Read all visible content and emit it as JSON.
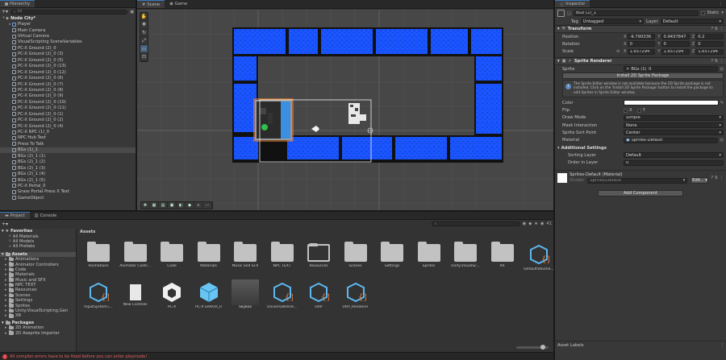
{
  "hierarchy": {
    "tab": "Hierarchy",
    "search_value": "All",
    "scene": "Node City*",
    "items": [
      {
        "label": "Player",
        "level": 1,
        "arrow": "▸"
      },
      {
        "label": "Main Camera",
        "level": 1,
        "arrow": ""
      },
      {
        "label": "Virtual Camera",
        "level": 1,
        "arrow": ""
      },
      {
        "label": "VisualScripting SceneVariables",
        "level": 1,
        "arrow": ""
      },
      {
        "label": "PC-X Ground (2)_0",
        "level": 1,
        "arrow": ""
      },
      {
        "label": "PC-X Ground (2)_0 (3)",
        "level": 1,
        "arrow": ""
      },
      {
        "label": "PC-X Ground (2)_0 (5)",
        "level": 1,
        "arrow": ""
      },
      {
        "label": "PC-X Ground (2)_0 (13)",
        "level": 1,
        "arrow": ""
      },
      {
        "label": "PC-X Ground (2)_0 (12)",
        "level": 1,
        "arrow": ""
      },
      {
        "label": "PC-X Ground (2)_0 (6)",
        "level": 1,
        "arrow": ""
      },
      {
        "label": "PC-X Ground (2)_0 (7)",
        "level": 1,
        "arrow": ""
      },
      {
        "label": "PC-X Ground (2)_0 (8)",
        "level": 1,
        "arrow": ""
      },
      {
        "label": "PC-X Ground (2)_0 (9)",
        "level": 1,
        "arrow": ""
      },
      {
        "label": "PC-X Ground (2)_0 (10)",
        "level": 1,
        "arrow": ""
      },
      {
        "label": "PC-X Ground (2)_0 (11)",
        "level": 1,
        "arrow": ""
      },
      {
        "label": "PC-X Ground (2)_0 (1)",
        "level": 1,
        "arrow": ""
      },
      {
        "label": "PC-X Ground (2)_0 (2)",
        "level": 1,
        "arrow": ""
      },
      {
        "label": "PC-X Ground (2)_0 (4)",
        "level": 1,
        "arrow": ""
      },
      {
        "label": "PC-X NPC (1)_0",
        "level": 1,
        "arrow": ""
      },
      {
        "label": "NPC Hub Text",
        "level": 1,
        "arrow": ""
      },
      {
        "label": "Press To Talk",
        "level": 1,
        "arrow": ""
      },
      {
        "label": "BGs (1)_1",
        "level": 1,
        "arrow": "",
        "selected": true
      },
      {
        "label": "BGs (2)_1 (1)",
        "level": 1,
        "arrow": ""
      },
      {
        "label": "BGs (2)_1 (2)",
        "level": 1,
        "arrow": ""
      },
      {
        "label": "BGs (2)_1 (3)",
        "level": 1,
        "arrow": ""
      },
      {
        "label": "BGs (2)_1 (4)",
        "level": 1,
        "arrow": ""
      },
      {
        "label": "BGs (2)_1 (5)",
        "level": 1,
        "arrow": ""
      },
      {
        "label": "PC-X Portal_0",
        "level": 1,
        "arrow": ""
      },
      {
        "label": "Grass Portal Press X Text",
        "level": 1,
        "arrow": ""
      },
      {
        "label": "GameObject",
        "level": 1,
        "arrow": ""
      }
    ]
  },
  "scene": {
    "tabs": [
      "Scene",
      "Game"
    ],
    "pivot": "Pivot",
    "local": "Local",
    "grid_snap": "1",
    "mode_2d": "2D"
  },
  "inspector": {
    "tab": "Inspector",
    "object_name": "BGs (2)_1",
    "static_label": "Static",
    "tag_label": "Tag",
    "tag_value": "Untagged",
    "layer_label": "Layer",
    "layer_value": "Default",
    "transform": {
      "title": "Transform",
      "position_label": "Position",
      "rotation_label": "Rotation",
      "scale_label": "Scale",
      "position": {
        "x": "-9.790336",
        "y": "0.9437847",
        "z": "0.2"
      },
      "rotation": {
        "x": "0",
        "y": "0",
        "z": "0"
      },
      "scale": {
        "x": "1.657294",
        "y": "1.657294",
        "z": "1.657294"
      }
    },
    "sprite_renderer": {
      "title": "Sprite Renderer",
      "sprite_label": "Sprite",
      "sprite_value": "BGs (1)_0",
      "install_button": "Install 2D Sprite Package",
      "help": "The Sprite Editor window is not available because the 2D Sprite package is not installed. Click on the 'Install 2D Sprite Package' button to install the package to edit Sprites in Sprite Editor window.",
      "color_label": "Color",
      "flip_label": "Flip",
      "flip_x": "X",
      "flip_y": "Y",
      "draw_mode_label": "Draw Mode",
      "draw_mode_value": "Simple",
      "mask_label": "Mask Interaction",
      "mask_value": "None",
      "sort_point_label": "Sprite Sort Point",
      "sort_point_value": "Center",
      "material_label": "Material",
      "material_value": "Sprites-Default",
      "additional_title": "Additional Settings",
      "sorting_layer_label": "Sorting Layer",
      "sorting_layer_value": "Default",
      "order_label": "Order in Layer",
      "order_value": "0"
    },
    "material": {
      "title": "Sprites-Default (Material)",
      "shader_label": "Shader",
      "shader_value": "Sprites/Default",
      "edit_button": "Edit..."
    },
    "add_component": "Add Component",
    "asset_labels": "Asset Labels"
  },
  "project": {
    "tabs": [
      "Project",
      "Console"
    ],
    "breadcrumb": "Assets",
    "item_count": "41",
    "favorites": {
      "title": "Favorites",
      "items": [
        "All Materials",
        "All Models",
        "All Prefabs"
      ]
    },
    "assets_tree": {
      "title": "Assets",
      "items": [
        "Animations",
        "Animator Controllers",
        "Code",
        "Materials",
        "Music and SFX",
        "NPC TEXT",
        "Resources",
        "Scenes",
        "Settings",
        "Sprites",
        "Unity.VisualScripting.Gen",
        "XR"
      ]
    },
    "packages": {
      "title": "Packages",
      "items": [
        "2D Animation",
        "2D Aseprite Importer"
      ]
    },
    "grid_row1": [
      "Animations",
      "Animator Contr...",
      "Code",
      "Materials",
      "Music and SFX",
      "NPC TEXT",
      "Resources",
      "Scenes",
      "Settings",
      "Sprites",
      "Unity.VisualSc...",
      "XR",
      "DefaultVolume..."
    ],
    "grid_row2": [
      "InputSystem.i...",
      "New Controls",
      "PC-X",
      "PC-X ERROR_0",
      "Skybox",
      "UniversalRend...",
      "URP",
      "URP_Renderer"
    ]
  },
  "status": {
    "message": "All compiler errors have to be fixed before you can enter playmode!"
  },
  "colors": {
    "accent": "#3a79bb",
    "tile_blue": "#1a55ff",
    "error": "#e06060"
  }
}
